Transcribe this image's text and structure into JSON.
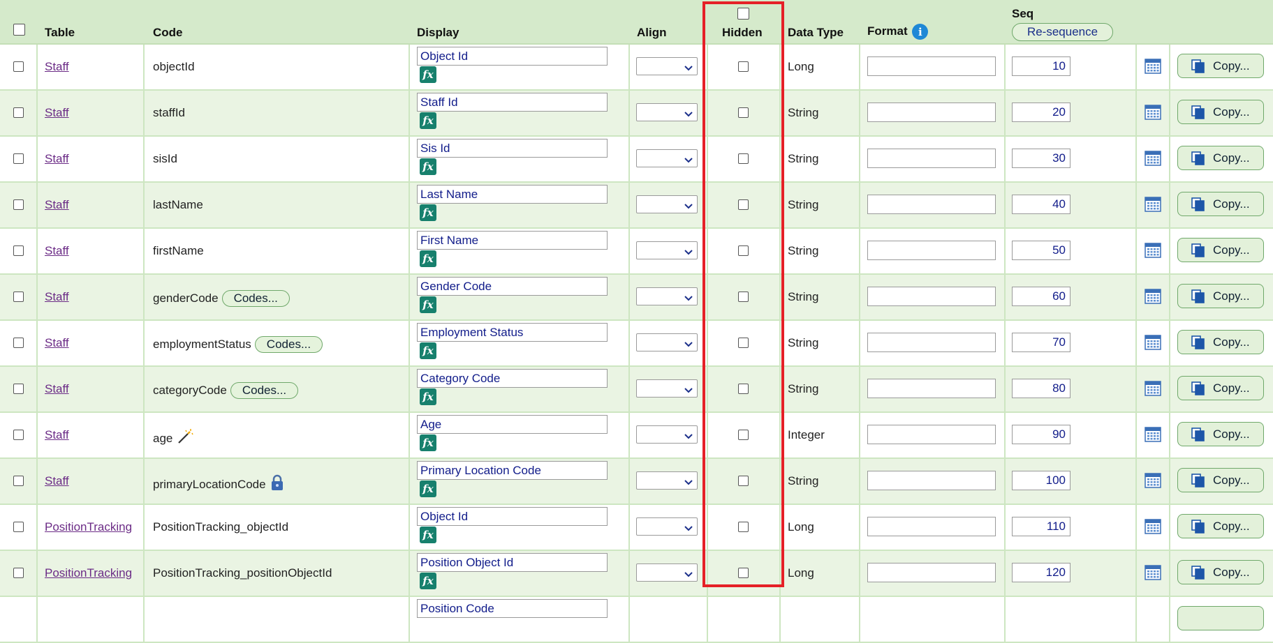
{
  "header": {
    "table": "Table",
    "code": "Code",
    "display": "Display",
    "align": "Align",
    "hidden": "Hidden",
    "data_type": "Data Type",
    "format": "Format",
    "seq": "Seq",
    "resequence_label": "Re-sequence"
  },
  "icons": {
    "info": "info-icon",
    "formula": "fx-icon",
    "calendar": "calendar-icon",
    "copy": "copy-icon",
    "wand": "magic-wand-icon",
    "lock": "lock-icon",
    "dropdown": "chevron-down-icon"
  },
  "colors": {
    "highlight": "#e52027",
    "link": "#6b2b86",
    "header_bg": "#d5eacb",
    "row_alt_bg": "#eaf4e3",
    "fx_bg": "#17806d"
  },
  "rows": [
    {
      "table": "Staff",
      "code": "objectId",
      "codes_btn": "",
      "badge": "",
      "display": "Object Id",
      "fx": "fx",
      "data_type": "Long",
      "format": "",
      "seq": "10",
      "copy": "Copy..."
    },
    {
      "table": "Staff",
      "code": "staffId",
      "codes_btn": "",
      "badge": "",
      "display": "Staff Id",
      "fx": "fx",
      "data_type": "String",
      "format": "",
      "seq": "20",
      "copy": "Copy..."
    },
    {
      "table": "Staff",
      "code": "sisId",
      "codes_btn": "",
      "badge": "",
      "display": "Sis Id",
      "fx": "fx",
      "data_type": "String",
      "format": "",
      "seq": "30",
      "copy": "Copy..."
    },
    {
      "table": "Staff",
      "code": "lastName",
      "codes_btn": "",
      "badge": "",
      "display": "Last Name",
      "fx": "fx",
      "data_type": "String",
      "format": "",
      "seq": "40",
      "copy": "Copy..."
    },
    {
      "table": "Staff",
      "code": "firstName",
      "codes_btn": "",
      "badge": "",
      "display": "First Name",
      "fx": "fx",
      "data_type": "String",
      "format": "",
      "seq": "50",
      "copy": "Copy..."
    },
    {
      "table": "Staff",
      "code": "genderCode",
      "codes_btn": "Codes...",
      "badge": "",
      "display": "Gender Code",
      "fx": "fx",
      "data_type": "String",
      "format": "",
      "seq": "60",
      "copy": "Copy..."
    },
    {
      "table": "Staff",
      "code": "employmentStatus",
      "codes_btn": "Codes...",
      "badge": "",
      "display": "Employment Status",
      "fx": "fx",
      "data_type": "String",
      "format": "",
      "seq": "70",
      "copy": "Copy..."
    },
    {
      "table": "Staff",
      "code": "categoryCode",
      "codes_btn": "Codes...",
      "badge": "",
      "display": "Category Code",
      "fx": "fx",
      "data_type": "String",
      "format": "",
      "seq": "80",
      "copy": "Copy..."
    },
    {
      "table": "Staff",
      "code": "age",
      "codes_btn": "",
      "badge": "wand",
      "display": "Age",
      "fx": "fx",
      "data_type": "Integer",
      "format": "",
      "seq": "90",
      "copy": "Copy..."
    },
    {
      "table": "Staff",
      "code": "primaryLocationCode",
      "codes_btn": "",
      "badge": "lock",
      "display": "Primary Location Code",
      "fx": "fx",
      "data_type": "String",
      "format": "",
      "seq": "100",
      "copy": "Copy..."
    },
    {
      "table": "PositionTracking",
      "code": "PositionTracking_objectId",
      "codes_btn": "",
      "badge": "",
      "display": "Object Id",
      "fx": "fx",
      "data_type": "Long",
      "format": "",
      "seq": "110",
      "copy": "Copy..."
    },
    {
      "table": "PositionTracking",
      "code": "PositionTracking_positionObjectId",
      "codes_btn": "",
      "badge": "",
      "display": "Position Object Id",
      "fx": "fx",
      "data_type": "Long",
      "format": "",
      "seq": "120",
      "copy": "Copy..."
    },
    {
      "table": "",
      "code": "",
      "codes_btn": "",
      "badge": "",
      "display": "Position Code",
      "fx": "",
      "data_type": "",
      "format": "",
      "seq": "",
      "copy": ""
    }
  ]
}
